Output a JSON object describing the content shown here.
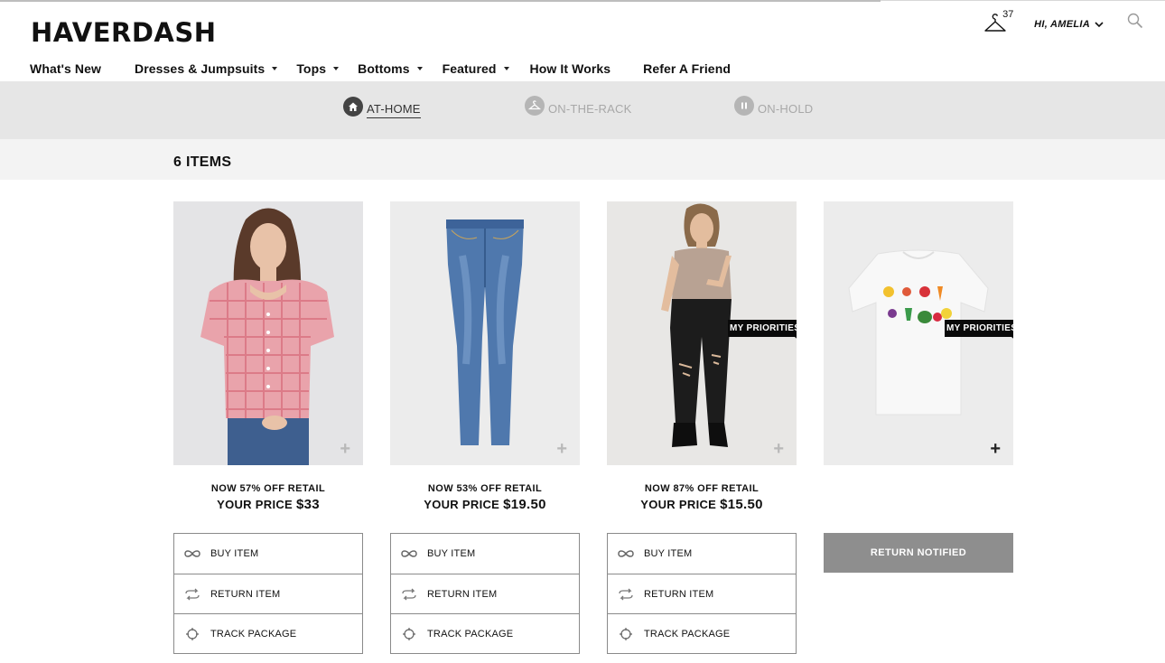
{
  "brand": "HAVERDASH",
  "header": {
    "hanger_count": "37",
    "greeting": "HI, AMELIA"
  },
  "nav": [
    {
      "label": "What's New",
      "has_dropdown": false
    },
    {
      "label": "Dresses & Jumpsuits",
      "has_dropdown": true
    },
    {
      "label": "Tops",
      "has_dropdown": true
    },
    {
      "label": "Bottoms",
      "has_dropdown": true
    },
    {
      "label": "Featured",
      "has_dropdown": true
    },
    {
      "label": "How It Works",
      "has_dropdown": false
    },
    {
      "label": "Refer A Friend",
      "has_dropdown": false
    }
  ],
  "tabs": [
    {
      "label": "AT-HOME",
      "icon": "home-icon",
      "active": true
    },
    {
      "label": "ON-THE-RACK",
      "icon": "hanger-icon",
      "active": false
    },
    {
      "label": "ON-HOLD",
      "icon": "pause-icon",
      "active": false
    }
  ],
  "items_count": "6 ITEMS",
  "products": [
    {
      "image": "pink plaid puff-sleeve top",
      "discount": "NOW 57% OFF RETAIL",
      "price_label": "YOUR PRICE",
      "price": "$33",
      "badge": "",
      "status": ""
    },
    {
      "image": "blue skinny jeans",
      "discount": "NOW 53% OFF RETAIL",
      "price_label": "YOUR PRICE",
      "price": "$19.50",
      "badge": "",
      "status": ""
    },
    {
      "image": "black ripped straight jeans",
      "discount": "NOW 87% OFF RETAIL",
      "price_label": "YOUR PRICE",
      "price": "$15.50",
      "badge": "MY PRIORITIES",
      "status": ""
    },
    {
      "image": "white fruit graphic tee",
      "discount": "",
      "price_label": "",
      "price": "",
      "badge": "MY PRIORITIES",
      "status": "RETURN NOTIFIED"
    }
  ],
  "actions": {
    "buy": "BUY ITEM",
    "return": "RETURN ITEM",
    "track": "TRACK PACKAGE"
  }
}
